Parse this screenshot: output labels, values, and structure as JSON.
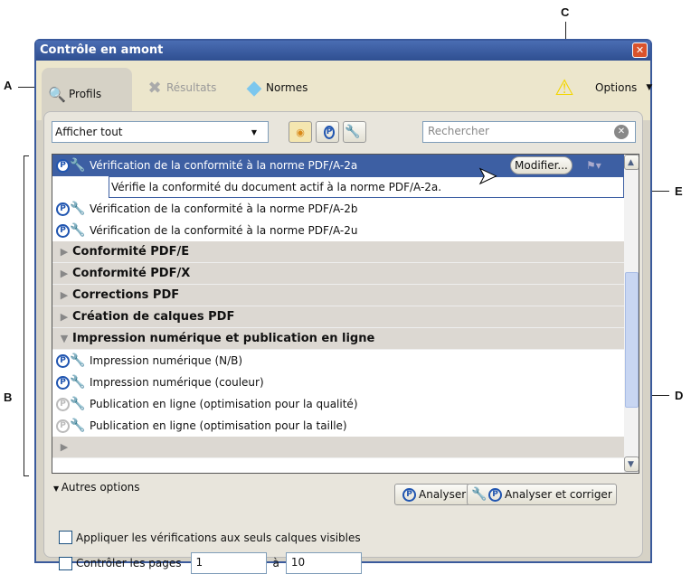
{
  "callouts": {
    "a": "A",
    "b": "B",
    "c": "C",
    "d": "D",
    "e": "E"
  },
  "window": {
    "title": "Contrôle en amont",
    "close": "✕"
  },
  "tabs": [
    {
      "label": "Profils"
    },
    {
      "label": "Résultats"
    },
    {
      "label": "Normes"
    }
  ],
  "options_label": "Options",
  "filter": {
    "value": "Afficher tout"
  },
  "search": {
    "placeholder": "Rechercher"
  },
  "list": {
    "selected": {
      "label": "Vérification de la conformité à la norme PDF/A-2a",
      "description": "Vérifie la conformité du document actif à la norme PDF/A-2a.",
      "edit_button": "Modifier..."
    },
    "items": [
      "Vérification de la conformité à la norme PDF/A-2b",
      "Vérification de la conformité à la norme PDF/A-2u"
    ],
    "categories": [
      "Conformité PDF/E",
      "Conformité PDF/X",
      "Corrections PDF",
      "Création de calques PDF",
      "Impression numérique et publication en ligne"
    ],
    "sub_items": [
      "Impression numérique (N/B)",
      "Impression numérique (couleur)",
      "Publication en ligne (optimisation pour la qualité)",
      "Publication en ligne (optimisation pour la taille)"
    ]
  },
  "more_options": "Autres options",
  "buttons": {
    "analyze": "Analyser",
    "analyze_fix": "Analyser et corriger"
  },
  "options": {
    "visible_layers": "Appliquer les vérifications aux seuls calques visibles",
    "check_pages": "Contrôler les pages",
    "from": "1",
    "to_label": "à",
    "to": "10"
  },
  "colors": {
    "titlebar": "#3a5a9c",
    "selection": "#3d5fa3"
  }
}
